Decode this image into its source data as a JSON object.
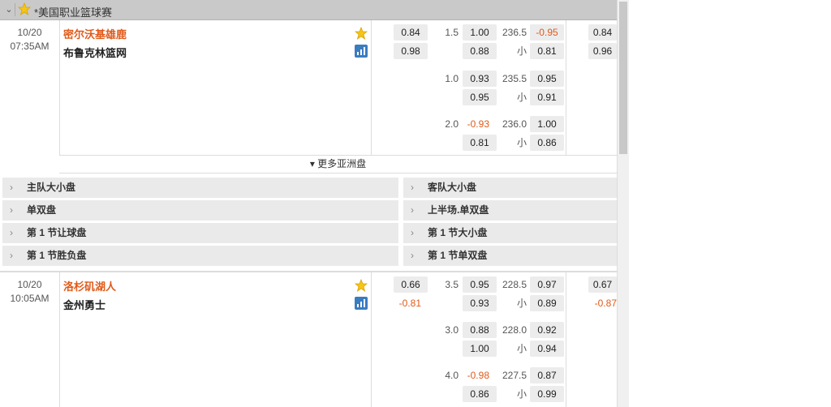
{
  "league": {
    "name": "*美国职业篮球赛",
    "collapse_icon": "chevron-down-icon",
    "star_icon": "star-icon"
  },
  "more_asian": "▾ 更多亚洲盘",
  "colors": {
    "home_team": "#e05a1a",
    "negative_odds": "#e05a1a",
    "header_bg": "#c9c9c9",
    "stat_icon": "#3a7cc0"
  },
  "matches": [
    {
      "date": "10/20",
      "time": "07:35AM",
      "home": "密尔沃基雄鹿",
      "away": "布鲁克林篮网",
      "ml": [
        "0.84",
        "0.98"
      ],
      "lines": [
        {
          "hcp": "1.5",
          "h1": "1.00",
          "h2": "0.88",
          "tot": "236.5",
          "small": "小",
          "o1": "-0.95",
          "o2": "0.81"
        },
        {
          "hcp": "1.0",
          "h1": "0.93",
          "h2": "0.95",
          "tot": "235.5",
          "small": "小",
          "o1": "0.95",
          "o2": "0.91"
        },
        {
          "hcp": "2.0",
          "h1": "-0.93",
          "h2": "0.81",
          "tot": "236.0",
          "small": "小",
          "o1": "1.00",
          "o2": "0.86"
        }
      ],
      "right": [
        "0.84",
        "0.96"
      ]
    },
    {
      "date": "10/20",
      "time": "10:05AM",
      "home": "洛杉矶湖人",
      "away": "金州勇士",
      "ml": [
        "0.66",
        "-0.81"
      ],
      "lines": [
        {
          "hcp": "3.5",
          "h1": "0.95",
          "h2": "0.93",
          "tot": "228.5",
          "small": "小",
          "o1": "0.97",
          "o2": "0.89"
        },
        {
          "hcp": "3.0",
          "h1": "0.88",
          "h2": "1.00",
          "tot": "228.0",
          "small": "小",
          "o1": "0.92",
          "o2": "0.94"
        },
        {
          "hcp": "4.0",
          "h1": "-0.98",
          "h2": "0.86",
          "tot": "227.5",
          "small": "小",
          "o1": "0.87",
          "o2": "0.99"
        }
      ],
      "right": [
        "0.67",
        "-0.87"
      ]
    }
  ],
  "markets": [
    [
      "主队大小盘",
      "客队大小盘"
    ],
    [
      "单双盘",
      "上半场.单双盘"
    ],
    [
      "第 1 节让球盘",
      "第 1 节大小盘"
    ],
    [
      "第 1 节胜负盘",
      "第 1 节单双盘"
    ]
  ]
}
